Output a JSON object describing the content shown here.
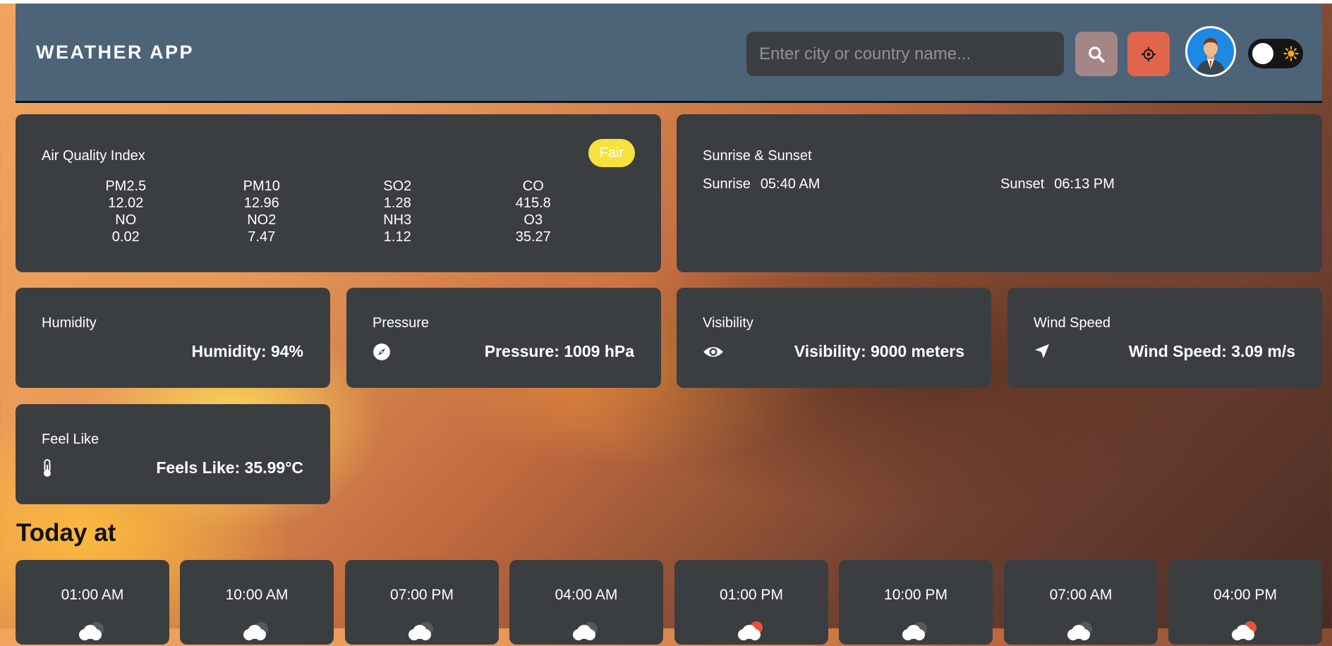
{
  "header": {
    "brand": "WEATHER APP",
    "search_placeholder": "Enter city or country name...",
    "search_button_icon": "search-icon",
    "location_button_icon": "crosshair-icon",
    "theme_toggle_icon": "sun-icon"
  },
  "air_quality": {
    "title": "Air Quality Index",
    "badge": "Fair",
    "badge_color": "#f7e13c",
    "pollutants": [
      {
        "name": "PM2.5",
        "value": "12.02"
      },
      {
        "name": "PM10",
        "value": "12.96"
      },
      {
        "name": "SO2",
        "value": "1.28"
      },
      {
        "name": "CO",
        "value": "415.8"
      },
      {
        "name": "NO",
        "value": "0.02"
      },
      {
        "name": "NO2",
        "value": "7.47"
      },
      {
        "name": "NH3",
        "value": "1.12"
      },
      {
        "name": "O3",
        "value": "35.27"
      }
    ]
  },
  "sun": {
    "title": "Sunrise & Sunset",
    "sunrise_label": "Sunrise",
    "sunrise_value": "05:40 AM",
    "sunset_label": "Sunset",
    "sunset_value": "06:13 PM"
  },
  "metrics": {
    "humidity": {
      "title": "Humidity",
      "value": "Humidity: 94%"
    },
    "pressure": {
      "title": "Pressure",
      "value": "Pressure: 1009 hPa",
      "icon": "compass-icon"
    },
    "visibility": {
      "title": "Visibility",
      "value": "Visibility: 9000 meters",
      "icon": "eye-icon"
    },
    "wind": {
      "title": "Wind Speed",
      "value": "Wind Speed: 3.09 m/s",
      "icon": "navigation-arrow-icon"
    },
    "feels": {
      "title": "Feel Like",
      "value": "Feels Like: 35.99°C",
      "icon": "thermometer-icon"
    }
  },
  "today": {
    "title": "Today at",
    "hours": [
      {
        "time": "01:00 AM",
        "icon": "cloudy-night-icon"
      },
      {
        "time": "10:00 AM",
        "icon": "cloudy-night-icon"
      },
      {
        "time": "07:00 PM",
        "icon": "cloudy-night-icon"
      },
      {
        "time": "04:00 AM",
        "icon": "cloudy-night-icon"
      },
      {
        "time": "01:00 PM",
        "icon": "cloudy-day-icon"
      },
      {
        "time": "10:00 PM",
        "icon": "cloudy-night-icon"
      },
      {
        "time": "07:00 AM",
        "icon": "cloudy-night-icon"
      },
      {
        "time": "04:00 PM",
        "icon": "cloudy-day-icon"
      }
    ]
  }
}
